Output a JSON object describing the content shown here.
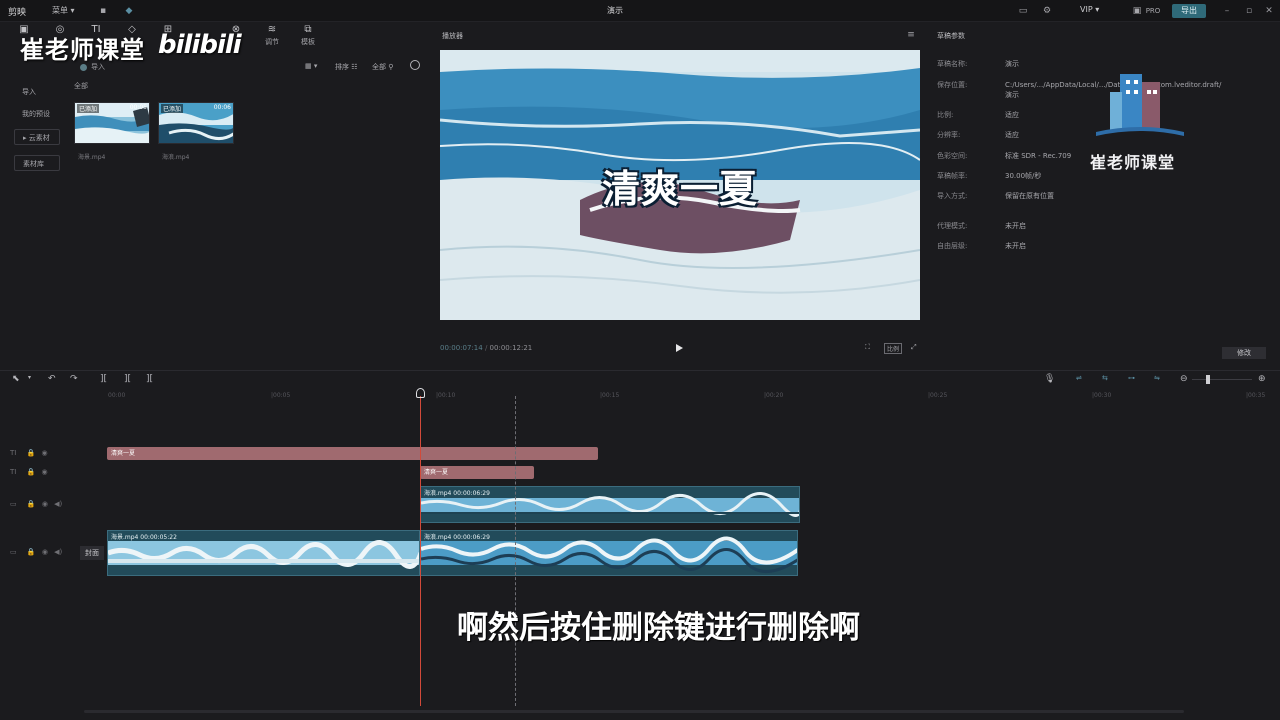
{
  "app": {
    "name": "剪映",
    "menu": "菜单 ▾",
    "doc_title": "演示",
    "vip": "VIP ▾",
    "pro": "PRO",
    "export": "导出"
  },
  "toolbar": {
    "tools": [
      {
        "icon": "▣",
        "label": ""
      },
      {
        "icon": "◎",
        "label": ""
      },
      {
        "icon": "TI",
        "label": ""
      },
      {
        "icon": "◇",
        "label": ""
      },
      {
        "icon": "⊞",
        "label": ""
      },
      {
        "icon": "⊗",
        "label": ""
      },
      {
        "icon": "≋",
        "label": "调节"
      },
      {
        "icon": "⧉",
        "label": "模板"
      }
    ]
  },
  "watermark": {
    "text": "崔老师课堂",
    "bili": "bilibili"
  },
  "library": {
    "sidebar": [
      "导入",
      "我的预设",
      "▸ 云素材",
      "素材库"
    ],
    "import_label": "导入",
    "all_label": "全部",
    "sort_labels": [
      "▦ ▾",
      "排序 ☷",
      "全部 ⚲"
    ],
    "thumbs": [
      {
        "added": "已添加",
        "duration": "00:05",
        "name": "海景.mp4"
      },
      {
        "added": "已添加",
        "duration": "00:06",
        "name": "海浪.mp4"
      }
    ]
  },
  "player": {
    "title": "播放器",
    "caption": "清爽一夏",
    "time_current": "00:00:07:14",
    "time_total": "00:00:12:21",
    "controls": [
      "⛶",
      "比例",
      "⤢"
    ]
  },
  "draft": {
    "title": "草稿参数",
    "rows": [
      {
        "k": "草稿名称:",
        "v": "演示"
      },
      {
        "k": "保存位置:",
        "v": "C:/Users/.../AppData/Local/.../Data/Projects/com.lveditor.draft/演示"
      },
      {
        "k": "比例:",
        "v": "适应"
      },
      {
        "k": "分辨率:",
        "v": "适应"
      },
      {
        "k": "色彩空间:",
        "v": "标准 SDR - Rec.709"
      },
      {
        "k": "草稿帧率:",
        "v": "30.00帧/秒"
      },
      {
        "k": "导入方式:",
        "v": "保留在原有位置"
      },
      {
        "k": "代理模式:",
        "v": "未开启"
      },
      {
        "k": "自由层级:",
        "v": "未开启"
      }
    ],
    "edit": "修改",
    "logo_text": "崔老师课堂"
  },
  "timeline": {
    "ruler": [
      "00:00",
      "|00:05",
      "|00:10",
      "|00:15",
      "|00:20",
      "|00:25",
      "|00:30",
      "|00:35"
    ],
    "text_clip_1": "清爽一夏",
    "text_clip_2": "清爽一夏",
    "video_upper": "海浪.mp4  00:00:06:29",
    "video_main_1": "海景.mp4  00:00:05:22",
    "video_main_2": "海浪.mp4  00:00:06:29",
    "cover": "封面"
  },
  "subtitle": "啊然后按住删除键进行删除啊",
  "colors": {
    "accent": "#2f6a79",
    "text_clip": "#a06a6f",
    "playhead": "#d24a3a",
    "video_clip": "#224b5a"
  }
}
